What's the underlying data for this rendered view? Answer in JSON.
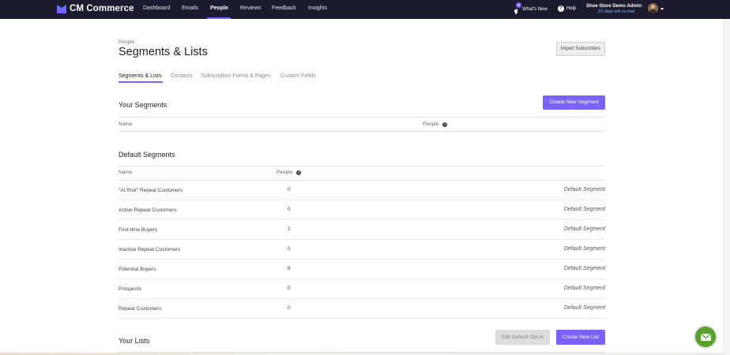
{
  "app": {
    "brand": "CM Commerce",
    "nav": [
      {
        "label": "Dashboard",
        "active": false
      },
      {
        "label": "Emails",
        "active": false
      },
      {
        "label": "People",
        "active": true
      },
      {
        "label": "Reviews",
        "active": false
      },
      {
        "label": "Feedback",
        "active": false
      },
      {
        "label": "Insights",
        "active": false
      }
    ],
    "whats_new": {
      "label": "What's New",
      "badge": "5"
    },
    "help": {
      "label": "Help"
    },
    "account": {
      "name": "Shoe Store Demo Admin",
      "trial": "22 days left on trial"
    }
  },
  "page": {
    "breadcrumb": "People",
    "title": "Segments & Lists",
    "import_button": "Import Subscribers",
    "tabs": [
      {
        "label": "Segments & Lists",
        "active": true
      },
      {
        "label": "Contacts",
        "active": false
      },
      {
        "label": "Subscription Forms & Pages",
        "active": false
      },
      {
        "label": "Custom Fields",
        "active": false
      }
    ]
  },
  "your_segments": {
    "title": "Your Segments",
    "create_button": "Create New Segment",
    "columns": {
      "name": "Name",
      "people": "People"
    }
  },
  "default_segments": {
    "title": "Default Segments",
    "columns": {
      "name": "Name",
      "people": "People"
    },
    "rows": [
      {
        "name": "\"At Risk\" Repeat Customers",
        "people": "0",
        "type": "Default Segment"
      },
      {
        "name": "Active Repeat Customers",
        "people": "0",
        "type": "Default Segment"
      },
      {
        "name": "First-time Buyers",
        "people": "2",
        "type": "Default Segment"
      },
      {
        "name": "Inactive Repeat Customers",
        "people": "0",
        "type": "Default Segment"
      },
      {
        "name": "Potential Buyers",
        "people": "8",
        "type": "Default Segment"
      },
      {
        "name": "Prospects",
        "people": "0",
        "type": "Default Segment"
      },
      {
        "name": "Repeat Customers",
        "people": "0",
        "type": "Default Segment"
      }
    ]
  },
  "your_lists": {
    "title": "Your Lists",
    "edit_button": "Edit Default Opt-in",
    "create_button": "Create New List"
  },
  "colors": {
    "nav_bg": "#1b1a2e",
    "accent": "#7b61ff",
    "chat_green": "#5aa02c"
  }
}
